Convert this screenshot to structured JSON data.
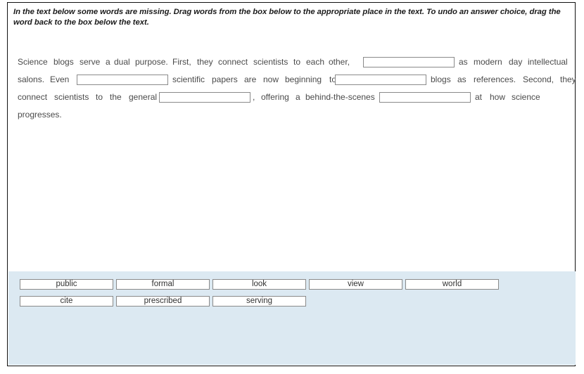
{
  "instructions": {
    "text": "In the text below some words are missing. Drag words from the box below to the appropriate place in the text. To undo an answer choice, drag the word back to the box below the text."
  },
  "passage": {
    "lines": [
      {
        "segments": [
          {
            "type": "text",
            "value": "Science"
          },
          {
            "type": "text",
            "value": "blogs"
          },
          {
            "type": "text",
            "value": "serve"
          },
          {
            "type": "text",
            "value": "a"
          },
          {
            "type": "text",
            "value": "dual"
          },
          {
            "type": "text",
            "value": "purpose."
          },
          {
            "type": "text",
            "value": "First,"
          },
          {
            "type": "text",
            "value": "they"
          },
          {
            "type": "text",
            "value": "connect"
          },
          {
            "type": "text",
            "value": "scientists"
          },
          {
            "type": "text",
            "value": "to"
          },
          {
            "type": "text",
            "value": "each"
          },
          {
            "type": "text",
            "value": "other,"
          },
          {
            "type": "blank",
            "value": ""
          },
          {
            "type": "text",
            "value": "as"
          },
          {
            "type": "text",
            "value": "modern"
          },
          {
            "type": "text",
            "value": "day"
          },
          {
            "type": "text",
            "value": "intellectual"
          }
        ]
      },
      {
        "segments": [
          {
            "type": "text",
            "value": "salons."
          },
          {
            "type": "text",
            "value": "Even"
          },
          {
            "type": "blank",
            "value": ""
          },
          {
            "type": "text",
            "value": "scientific"
          },
          {
            "type": "text",
            "value": "papers"
          },
          {
            "type": "text",
            "value": "are"
          },
          {
            "type": "text",
            "value": "now"
          },
          {
            "type": "text",
            "value": "beginning"
          },
          {
            "type": "text",
            "value": "to"
          },
          {
            "type": "blank",
            "value": ""
          },
          {
            "type": "text",
            "value": "blogs"
          },
          {
            "type": "text",
            "value": "as"
          },
          {
            "type": "text",
            "value": "references."
          },
          {
            "type": "text",
            "value": "Second,"
          },
          {
            "type": "text",
            "value": "they"
          }
        ]
      },
      {
        "segments": [
          {
            "type": "text",
            "value": "connect"
          },
          {
            "type": "text",
            "value": "scientists"
          },
          {
            "type": "text",
            "value": "to"
          },
          {
            "type": "text",
            "value": "the"
          },
          {
            "type": "text",
            "value": "general"
          },
          {
            "type": "blank",
            "value": ""
          },
          {
            "type": "text",
            "value": ","
          },
          {
            "type": "text",
            "value": "offering"
          },
          {
            "type": "text",
            "value": "a"
          },
          {
            "type": "text",
            "value": "behind-the-scenes"
          },
          {
            "type": "blank",
            "value": ""
          },
          {
            "type": "text",
            "value": "at"
          },
          {
            "type": "text",
            "value": "how"
          },
          {
            "type": "text",
            "value": "science"
          }
        ]
      },
      {
        "segments": [
          {
            "type": "text",
            "value": "progresses."
          }
        ]
      }
    ]
  },
  "word_bank": {
    "rows": [
      [
        {
          "label": "public"
        },
        {
          "label": "formal"
        },
        {
          "label": "look"
        },
        {
          "label": "view"
        },
        {
          "label": "world"
        }
      ],
      [
        {
          "label": "cite"
        },
        {
          "label": "prescribed"
        },
        {
          "label": "serving"
        }
      ]
    ]
  },
  "colors": {
    "panel_background": "#dce9f2",
    "frame_border": "#111111",
    "blank_border": "#8a8a8a",
    "passage_text": "#4a4a4a",
    "instruction_text": "#1b1b1b"
  }
}
